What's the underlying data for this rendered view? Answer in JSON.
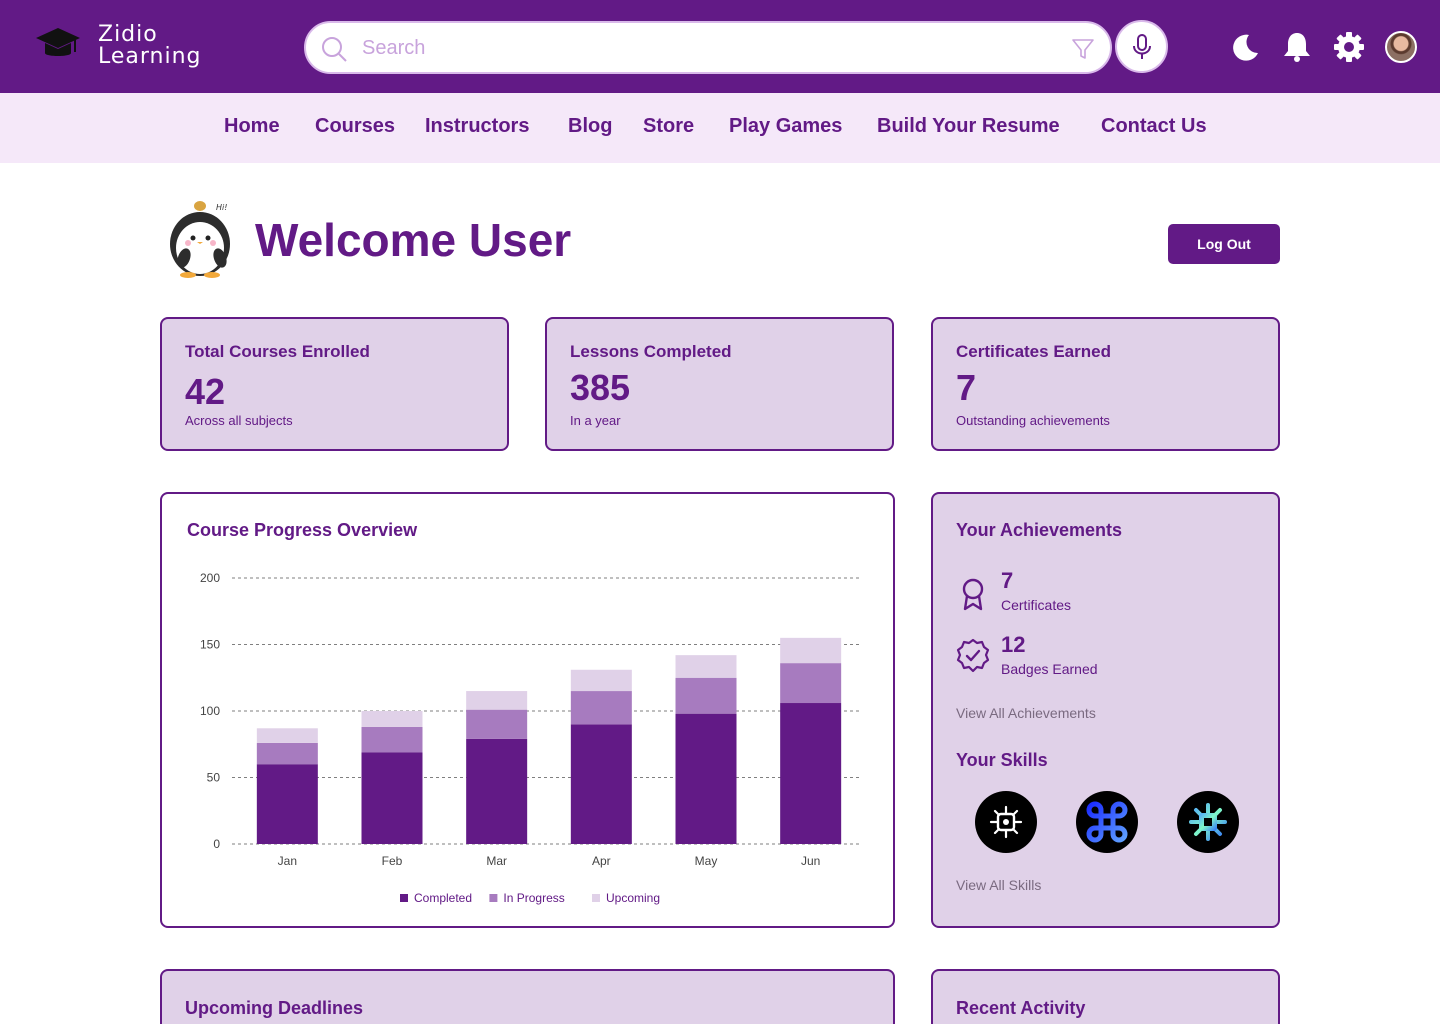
{
  "brand": {
    "line1": "Zidio",
    "line2": "Learning",
    "accent": "#621a86"
  },
  "search": {
    "placeholder": "Search",
    "value": ""
  },
  "header_icons": [
    "moon-icon",
    "bell-icon",
    "gear-icon",
    "avatar"
  ],
  "nav": [
    "Home",
    "Courses",
    "Instructors",
    "Blog",
    "Store",
    "Play Games",
    "Build Your Resume",
    "Contact Us"
  ],
  "welcome": {
    "title": "Welcome User",
    "mascot_text": "Hi!",
    "logout_label": "Log Out"
  },
  "stats": [
    {
      "title": "Total Courses Enrolled",
      "value": "42",
      "subtitle": "Across all subjects"
    },
    {
      "title": "Lessons Completed",
      "value": "385",
      "subtitle": "In a year"
    },
    {
      "title": "Certificates Earned",
      "value": "7",
      "subtitle": "Outstanding achievements"
    }
  ],
  "chart_card": {
    "title": "Course Progress Overview"
  },
  "chart_data": {
    "type": "bar",
    "stacked": true,
    "title": "Course Progress Overview",
    "categories": [
      "Jan",
      "Feb",
      "Mar",
      "Apr",
      "May",
      "Jun"
    ],
    "series": [
      {
        "name": "Completed",
        "values": [
          60,
          69,
          79,
          90,
          98,
          106
        ],
        "color": "#621a86"
      },
      {
        "name": "In Progress",
        "values": [
          16,
          19,
          22,
          25,
          27,
          30
        ],
        "color": "#a77bbf"
      },
      {
        "name": "Upcoming",
        "values": [
          11,
          12,
          14,
          16,
          17,
          19
        ],
        "color": "#e0d1e8"
      }
    ],
    "ylim": [
      0,
      200
    ],
    "yticks": [
      "0",
      "50",
      "100",
      "150",
      "200"
    ],
    "grid": true,
    "legend": "bottom"
  },
  "achievements": {
    "title": "Your Achievements",
    "items": [
      {
        "value": "7",
        "label": "Certificates",
        "icon": "award-ribbon-icon"
      },
      {
        "value": "12",
        "label": "Badges Earned",
        "icon": "badge-check-icon"
      }
    ],
    "view_all": "View All Achievements",
    "skills_title": "Your Skills",
    "skills_icons": [
      "skill-ai-icon",
      "skill-command-icon",
      "skill-chip-icon"
    ],
    "view_all_skills": "View All Skills"
  },
  "bottom": {
    "deadlines_title": "Upcoming Deadlines",
    "activity_title": "Recent Activity"
  }
}
